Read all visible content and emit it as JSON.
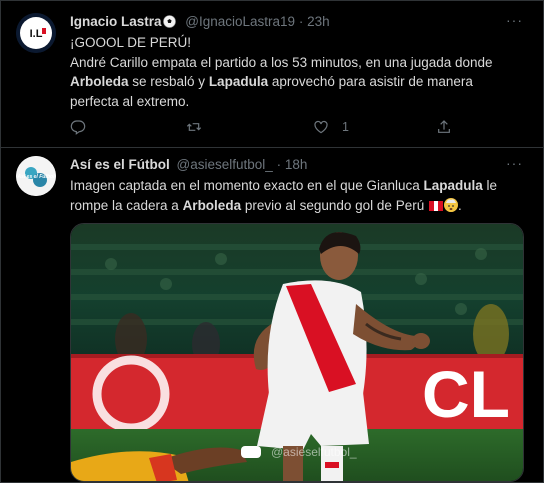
{
  "tweet1": {
    "author_name": "Ignacio Lastra",
    "handle": "@IgnacioLastra19",
    "separator": "·",
    "time": "23h",
    "more": "···",
    "avatar_text": "I.L",
    "line1": "¡GOOOL DE PERÚ!",
    "line2_a": "André Carillo empata el partido a los 53 minutos, en una jugada donde",
    "line3_a": "Arboleda",
    "line3_b": " se resbaló y ",
    "line3_c": "Lapadula",
    "line3_d": " aprovechó para asistir de manera",
    "line4": "perfecta al extremo.",
    "like_count": "1"
  },
  "tweet2": {
    "author_name": "Así es el Fútbol",
    "handle": "@asieselfutbol_",
    "separator": "·",
    "time": "18h",
    "more": "···",
    "avatar_text": "Así es el Fútbol",
    "line1_a": "Imagen captada en el momento exacto en el que Gianluca ",
    "line1_b": "Lapadula",
    "line1_c": " le",
    "line2_a": "rompe la cadera a ",
    "line2_b": "Arboleda",
    "line2_c": " previo al segundo gol de Perú ",
    "line2_d": ".",
    "watermark": "@asieselfutbol_",
    "sign_text": "CL"
  },
  "colors": {
    "background": "#000000",
    "text": "#d9d9d9",
    "secondary": "#6e767d",
    "border": "#2f3336",
    "peru_red": "#d91023"
  },
  "icons": [
    "reply-icon",
    "retweet-icon",
    "like-icon",
    "share-icon",
    "soccer-ball-icon",
    "peru-flag-icon",
    "exploding-head-icon"
  ]
}
